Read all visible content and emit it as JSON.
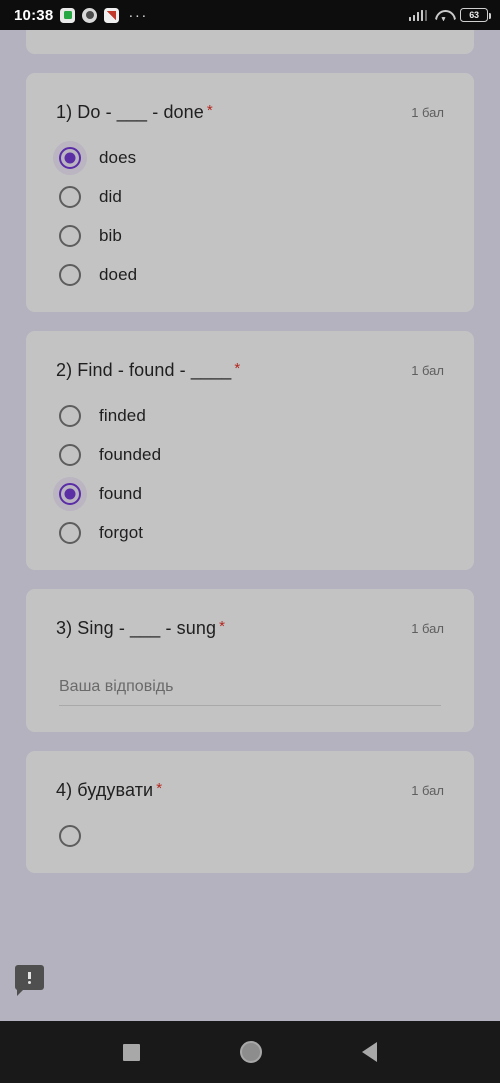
{
  "status_bar": {
    "time": "10:38",
    "icons": [
      "app-green-icon",
      "app-circle-icon",
      "app-chart-icon"
    ],
    "overflow_dots": "···",
    "signal_icon": "cellular-signal-icon",
    "wifi_icon": "wifi-icon",
    "battery_level": "63"
  },
  "form": {
    "questions": [
      {
        "id": "q1",
        "title": "1) Do - ___ - done",
        "required_marker": "*",
        "points": "1 бал",
        "type": "radio",
        "options": [
          {
            "label": "does",
            "selected": true
          },
          {
            "label": "did",
            "selected": false
          },
          {
            "label": "bib",
            "selected": false
          },
          {
            "label": "doed",
            "selected": false
          }
        ]
      },
      {
        "id": "q2",
        "title": "2) Find - found - ____",
        "required_marker": "*",
        "points": "1 бал",
        "type": "radio",
        "options": [
          {
            "label": "finded",
            "selected": false
          },
          {
            "label": "founded",
            "selected": false
          },
          {
            "label": "found",
            "selected": true
          },
          {
            "label": "forgot",
            "selected": false
          }
        ]
      },
      {
        "id": "q3",
        "title": "3) Sing - ___ - sung",
        "required_marker": "*",
        "points": "1 бал",
        "type": "short-answer",
        "answer_value": "",
        "answer_placeholder": "Ваша відповідь"
      },
      {
        "id": "q4",
        "title": "4) будувати",
        "required_marker": "*",
        "points": "1 бал",
        "type": "partial"
      }
    ],
    "feedback_icon": "feedback-bubble-icon"
  },
  "nav_bar": {
    "recents": "recents-square-icon",
    "home": "home-circle-icon",
    "back": "back-triangle-icon"
  },
  "colors": {
    "page_background": "#b4b2be",
    "card_background": "#c4c3c4",
    "accent_purple": "#5b2ea6",
    "required_red": "#b3261e",
    "status_bar": "#0d0d0d",
    "nav_bar": "#191919"
  }
}
